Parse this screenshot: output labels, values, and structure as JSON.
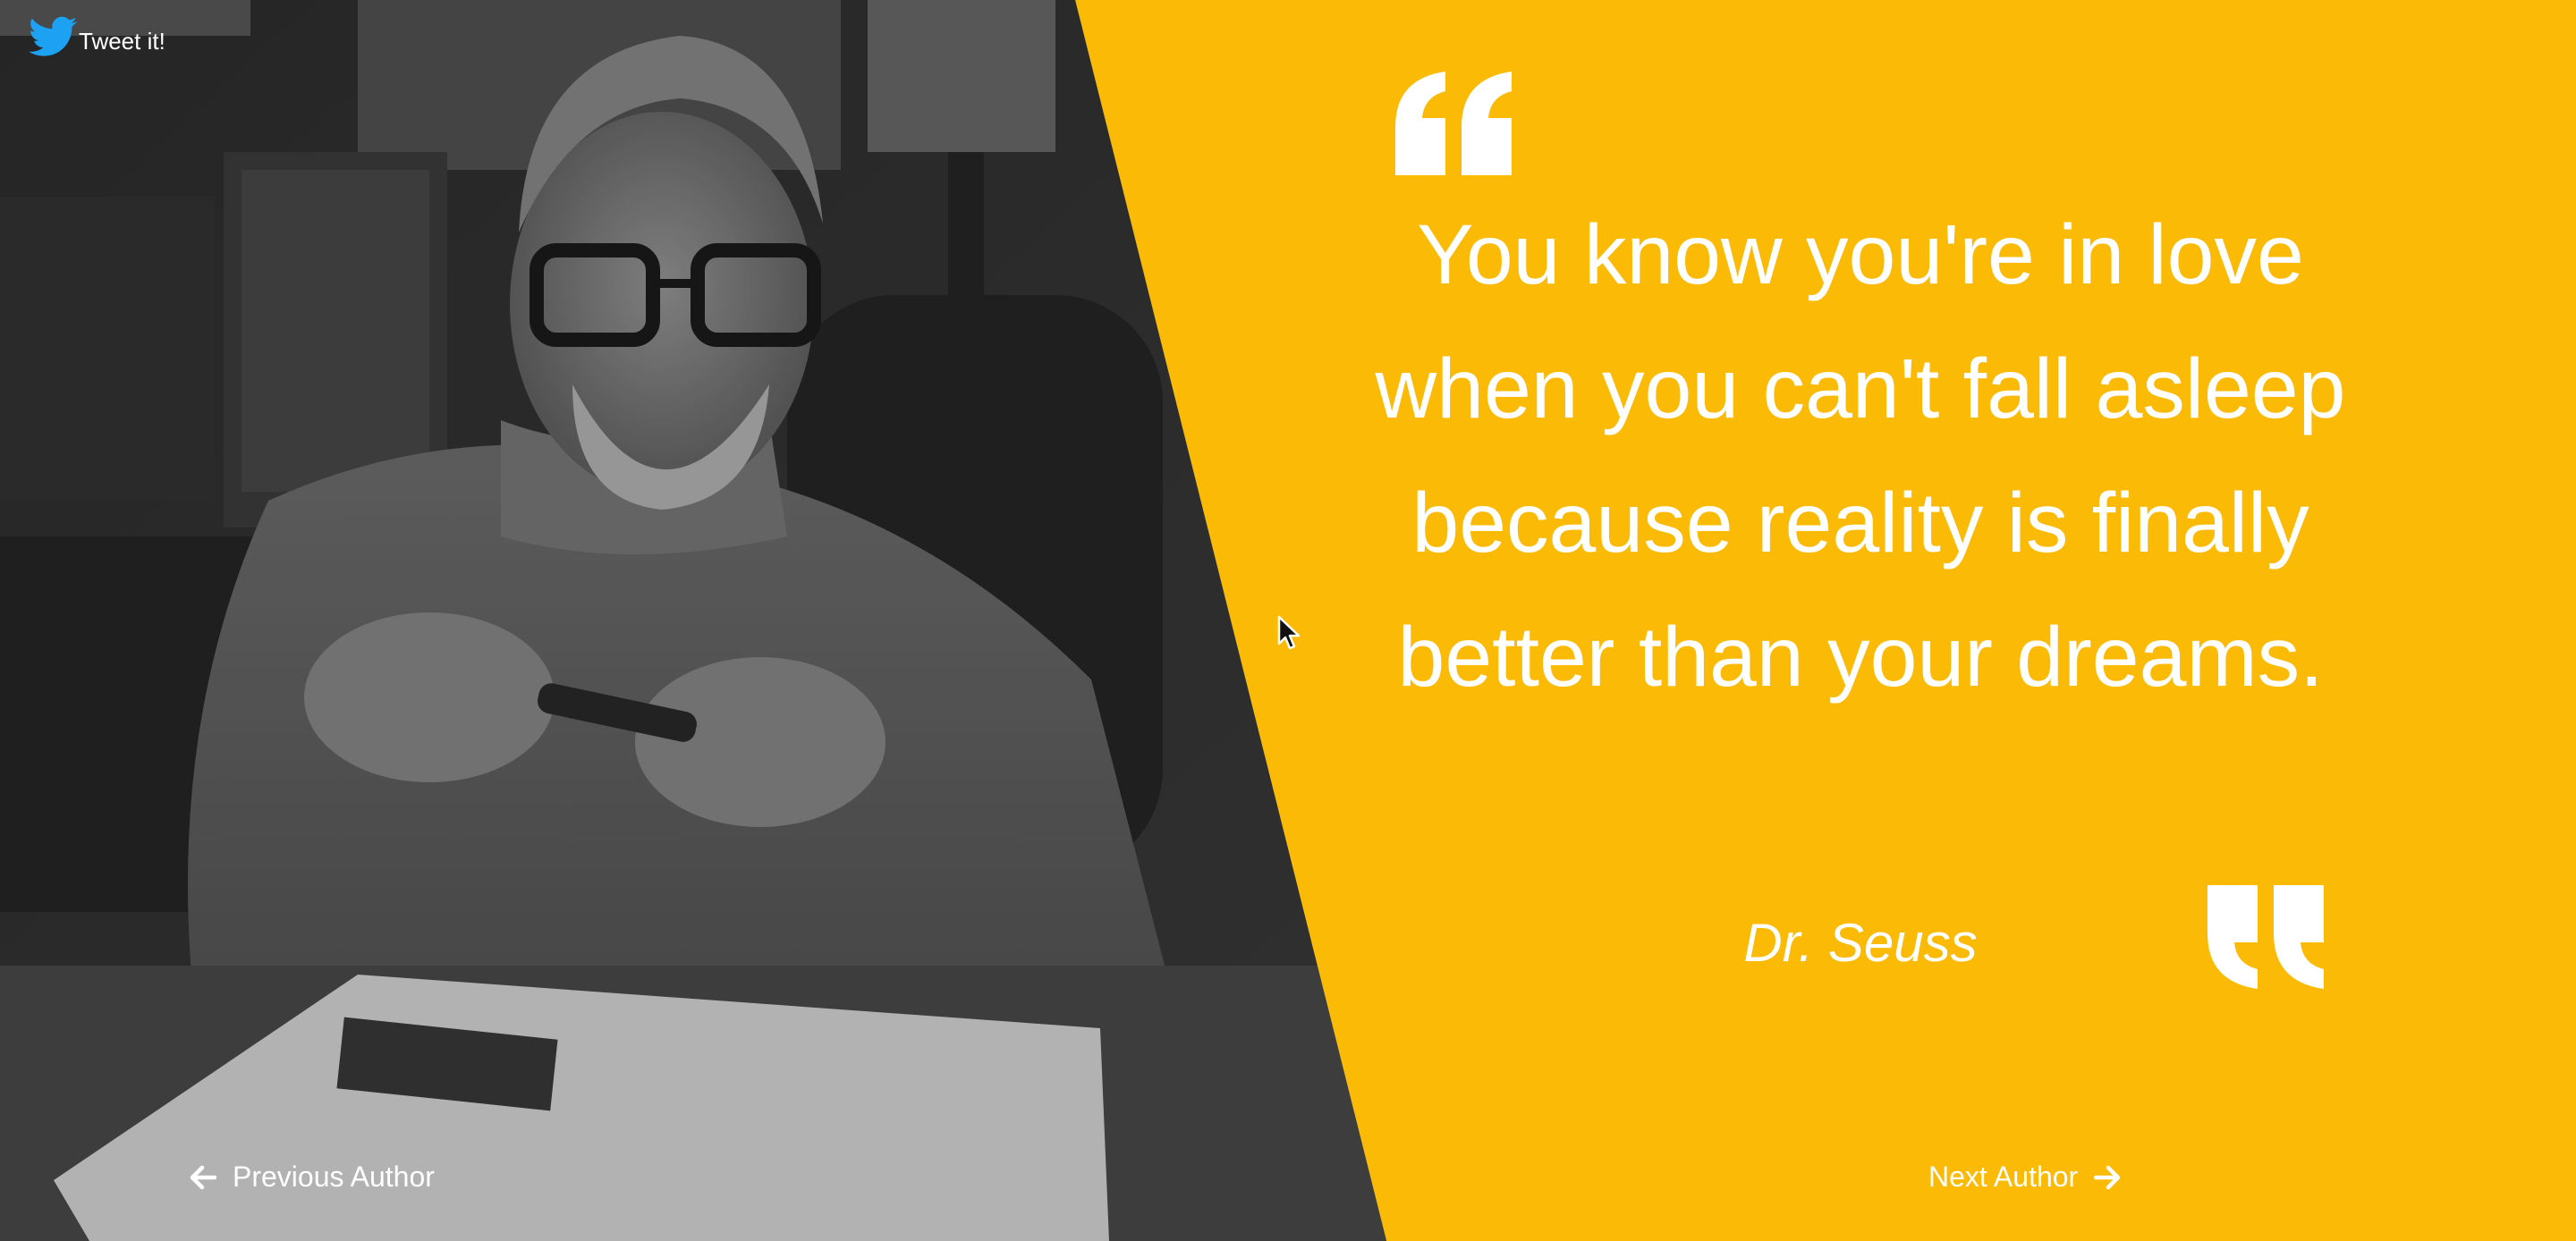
{
  "tweet": {
    "label": "Tweet it!",
    "icon": "twitter-bird-icon"
  },
  "quote": {
    "text": "You know you're in love when you can't fall asleep because reality is finally better than your dreams.",
    "author": "Dr. Seuss",
    "open_icon": "open-quote-icon",
    "close_icon": "close-quote-icon"
  },
  "navigation": {
    "previous_label": "Previous Author",
    "next_label": "Next Author",
    "previous_icon": "arrow-left-icon",
    "next_icon": "arrow-right-icon"
  },
  "photo": {
    "description_icon": "author-portrait"
  },
  "colors": {
    "accent": "#fbba06",
    "text": "#ffffff"
  }
}
